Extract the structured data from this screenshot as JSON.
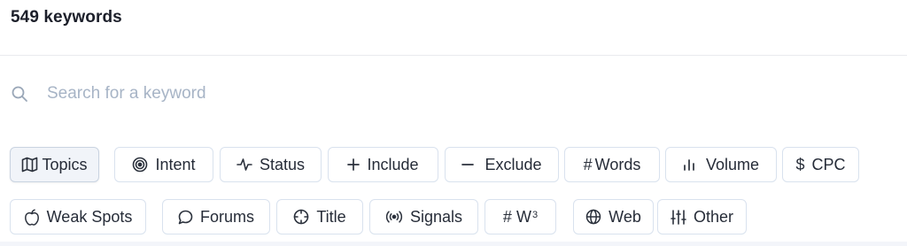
{
  "header": {
    "title": "549 keywords"
  },
  "search": {
    "placeholder": "Search for a keyword",
    "icon": "search-icon"
  },
  "filters_row1": [
    {
      "label": "Topics",
      "icon": "map-icon",
      "active": true
    },
    {
      "label": "Intent",
      "icon": "target-icon",
      "active": false
    },
    {
      "label": "Status",
      "icon": "activity-icon",
      "active": false
    },
    {
      "label": "Include",
      "icon": "plus-icon",
      "active": false
    },
    {
      "label": "Exclude",
      "icon": "minus-icon",
      "active": false
    },
    {
      "label": "Words",
      "icon": "hash-icon",
      "active": false
    },
    {
      "label": "Volume",
      "icon": "bar-chart-icon",
      "active": false
    },
    {
      "label": "CPC",
      "icon": "dollar-icon",
      "active": false
    }
  ],
  "filters_row2": [
    {
      "label": "Weak Spots",
      "icon": "apple-icon",
      "active": false
    },
    {
      "label": "Forums",
      "icon": "chat-bubble-icon",
      "active": false
    },
    {
      "label": "Title",
      "icon": "crosshair-icon",
      "active": false
    },
    {
      "label": "Signals",
      "icon": "broadcast-icon",
      "active": false
    },
    {
      "label": "W",
      "superscript": "3",
      "icon": "hash-icon",
      "active": false
    },
    {
      "label": "Web",
      "icon": "globe-icon",
      "active": false
    },
    {
      "label": "Other",
      "icon": "sliders-icon",
      "active": false
    }
  ],
  "colors": {
    "chip_border": "#d9e2ee",
    "active_bg": "#f1f4f9",
    "placeholder": "#a7b4c6",
    "text": "#262c38"
  }
}
